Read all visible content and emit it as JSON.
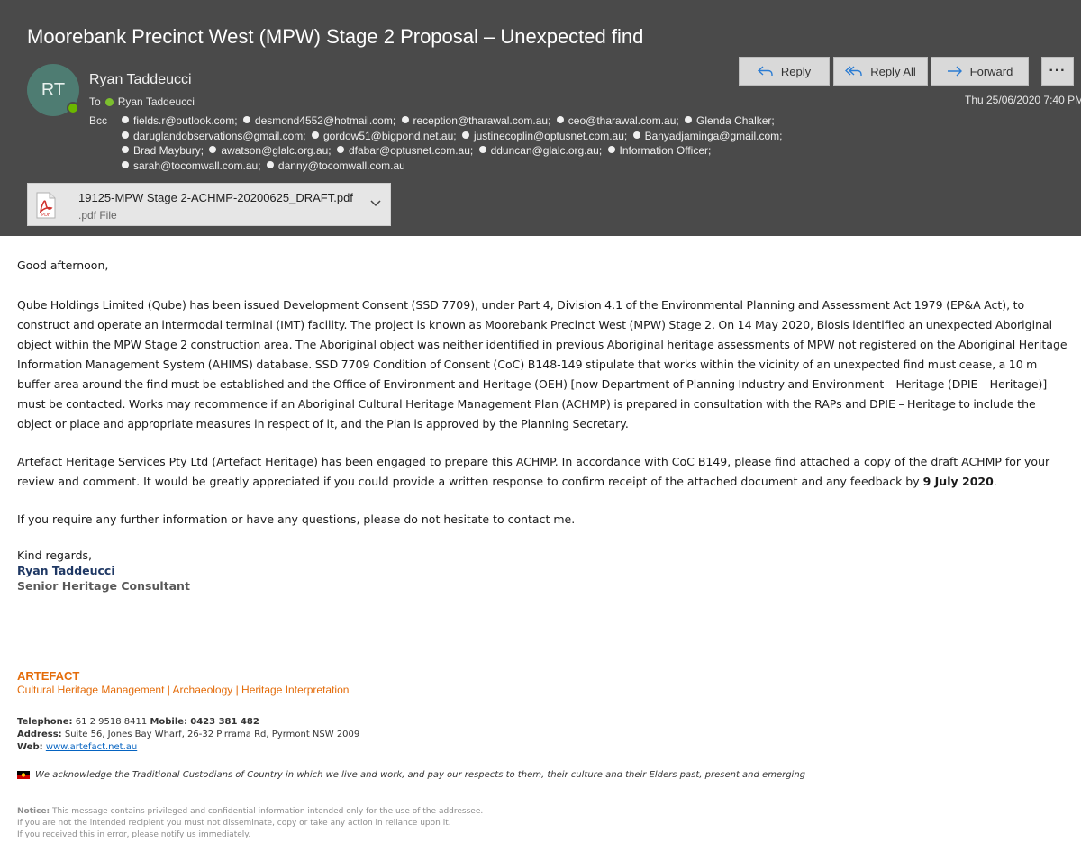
{
  "email": {
    "subject": "Moorebank Precinct West (MPW) Stage 2 Proposal – Unexpected find",
    "avatar_initials": "RT",
    "sender_name": "Ryan Taddeucci",
    "to_label": "To",
    "to_name": "Ryan Taddeucci",
    "bcc_label": "Bcc",
    "bcc": [
      "fields.r@outlook.com;",
      "desmond4552@hotmail.com;",
      "reception@tharawal.com.au;",
      "ceo@tharawal.com.au;",
      "Glenda Chalker;",
      "daruglandobservations@gmail.com;",
      "gordow51@bigpond.net.au;",
      "justinecoplin@optusnet.com.au;",
      "Banyadjaminga@gmail.com;",
      "Brad Maybury;",
      "awatson@glalc.org.au;",
      "dfabar@optusnet.com.au;",
      "dduncan@glalc.org.au;",
      "Information Officer;",
      "sarah@tocomwall.com.au;",
      "danny@tocomwall.com.au"
    ],
    "date": "Thu 25/06/2020 7:40 PM",
    "attachment": {
      "name": "19125-MPW Stage 2-ACHMP-20200625_DRAFT.pdf",
      "type": ".pdf File",
      "icon_text": "PDF"
    }
  },
  "toolbar": {
    "reply": "Reply",
    "reply_all": "Reply All",
    "forward": "Forward",
    "more": "···"
  },
  "body": {
    "greeting": "Good afternoon,",
    "para1": "Qube Holdings Limited (Qube) has been issued Development Consent (SSD 7709), under Part 4, Division 4.1 of the Environmental Planning and Assessment Act 1979 (EP&A Act), to construct and operate an intermodal terminal (IMT) facility. The project is known as Moorebank Precinct West (MPW) Stage 2.  On 14 May 2020, Biosis identified an unexpected Aboriginal object within the MPW Stage 2 construction area. The Aboriginal object was neither identified in previous Aboriginal heritage assessments of MPW not registered on the Aboriginal Heritage Information Management System (AHIMS) database. SSD 7709 Condition of Consent (CoC) B148-149 stipulate that works within the vicinity of an unexpected find must cease, a 10 m buffer area around the find must be established and the Office of Environment and Heritage (OEH) [now Department of Planning Industry and Environment – Heritage (DPIE – Heritage)] must be contacted. Works may recommence if an Aboriginal Cultural Heritage Management Plan (ACHMP) is prepared in consultation with the RAPs and DPIE – Heritage to include the object or place and appropriate measures in respect of it, and the Plan is approved by the Planning Secretary.",
    "para2": "Artefact Heritage Services Pty Ltd (Artefact Heritage) has been engaged to prepare this ACHMP. In accordance with CoC B149, please find attached a copy of the draft ACHMP for your review and comment. It would be greatly appreciated if you could provide a written response to confirm receipt of the attached document and any feedback by ",
    "para2_bold": "9 July 2020",
    "para2_end": ".",
    "para3": "If you require any further information or have any questions, please do not hesitate to contact me.",
    "closing": "Kind regards,"
  },
  "signature": {
    "name": "Ryan Taddeucci",
    "title": "Senior Heritage Consultant",
    "company": "ARTEFACT",
    "tagline": "Cultural Heritage Management | Archaeology | Heritage Interpretation",
    "telephone_label": "Telephone:",
    "telephone": "61 2 9518 8411",
    "mobile_label": "Mobile:",
    "mobile": "0423 381 482",
    "address_label": "Address:",
    "address": "Suite 56, Jones Bay Wharf, 26-32 Pirrama Rd, Pyrmont NSW 2009",
    "web_label": "Web:",
    "web": "www.artefact.net.au",
    "acknowledgement": "We acknowledge the Traditional Custodians of Country in which we live and work, and pay our respects to them, their culture and their Elders past, present and emerging",
    "notice_label": "Notice:",
    "notice_1": "This message contains privileged and confidential information intended only for the use of the addressee.",
    "notice_2": "If you are not the intended recipient you must not disseminate, copy or take any action in reliance upon it.",
    "notice_3": "If you received this in error, please notify us immediately."
  },
  "colors": {
    "header_bg": "#4a4a4a",
    "accent_blue": "#2b7cd3",
    "signature_name": "#1f3864",
    "brand_orange": "#e46c0a",
    "link": "#0563c1"
  }
}
